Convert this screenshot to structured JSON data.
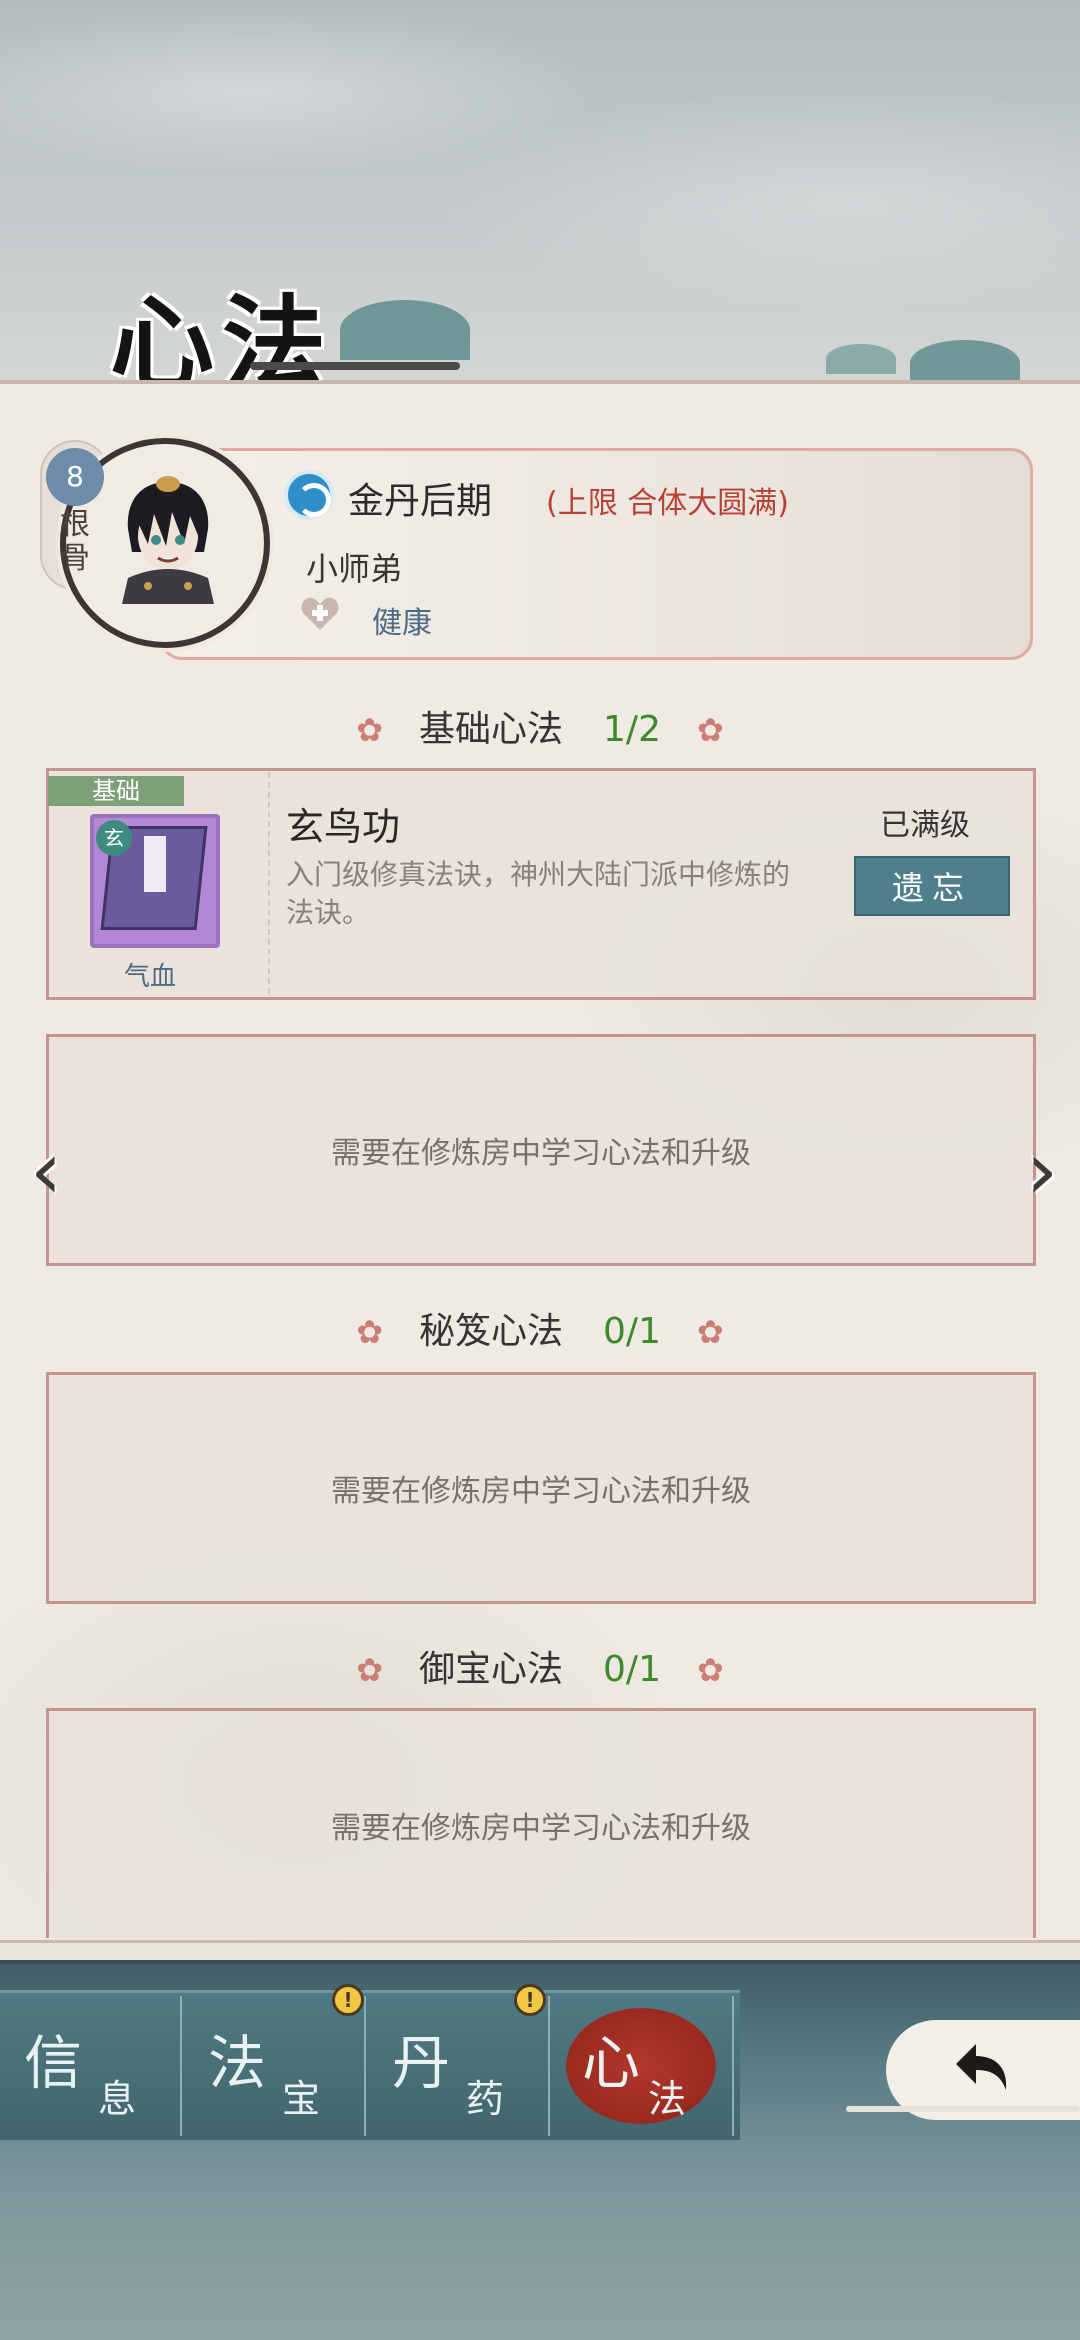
{
  "header": {
    "title": "心法"
  },
  "profile": {
    "root_bone_value": "8",
    "root_bone_label": "根骨",
    "realm": "金丹后期",
    "realm_limit": "(上限 合体大圆满)",
    "name": "小师弟",
    "health": "健康",
    "icons": {
      "realm": "realm-swirl-icon",
      "health": "heart-plus-icon"
    }
  },
  "sections": [
    {
      "title": "基础心法",
      "count": "1/2"
    },
    {
      "title": "秘笈心法",
      "count": "0/1"
    },
    {
      "title": "御宝心法",
      "count": "0/1"
    }
  ],
  "basic_skill": {
    "tag": "基础",
    "badge": "玄",
    "name": "玄鸟功",
    "description": "入门级修真法诀，神州大陆门派中修炼的法诀。",
    "attribute": "气血",
    "status": "已满级",
    "forget_button": "遗忘"
  },
  "empty_slot_text": "需要在修炼房中学习心法和升级",
  "nav_arrows": {
    "left": "‹",
    "right": "›"
  },
  "tabs": [
    {
      "big": "信",
      "small": "息",
      "alert": false,
      "active": false
    },
    {
      "big": "法",
      "small": "宝",
      "alert": true,
      "active": false
    },
    {
      "big": "丹",
      "small": "药",
      "alert": true,
      "active": false
    },
    {
      "big": "心",
      "small": "法",
      "alert": false,
      "active": true
    }
  ],
  "alert_symbol": "!",
  "back_button_icon": "back-arrow-icon",
  "colors": {
    "accent_red": "#b84136",
    "count_green": "#3c8a2a",
    "button_teal": "#4f7e8c",
    "slot_border": "#c5948d"
  }
}
